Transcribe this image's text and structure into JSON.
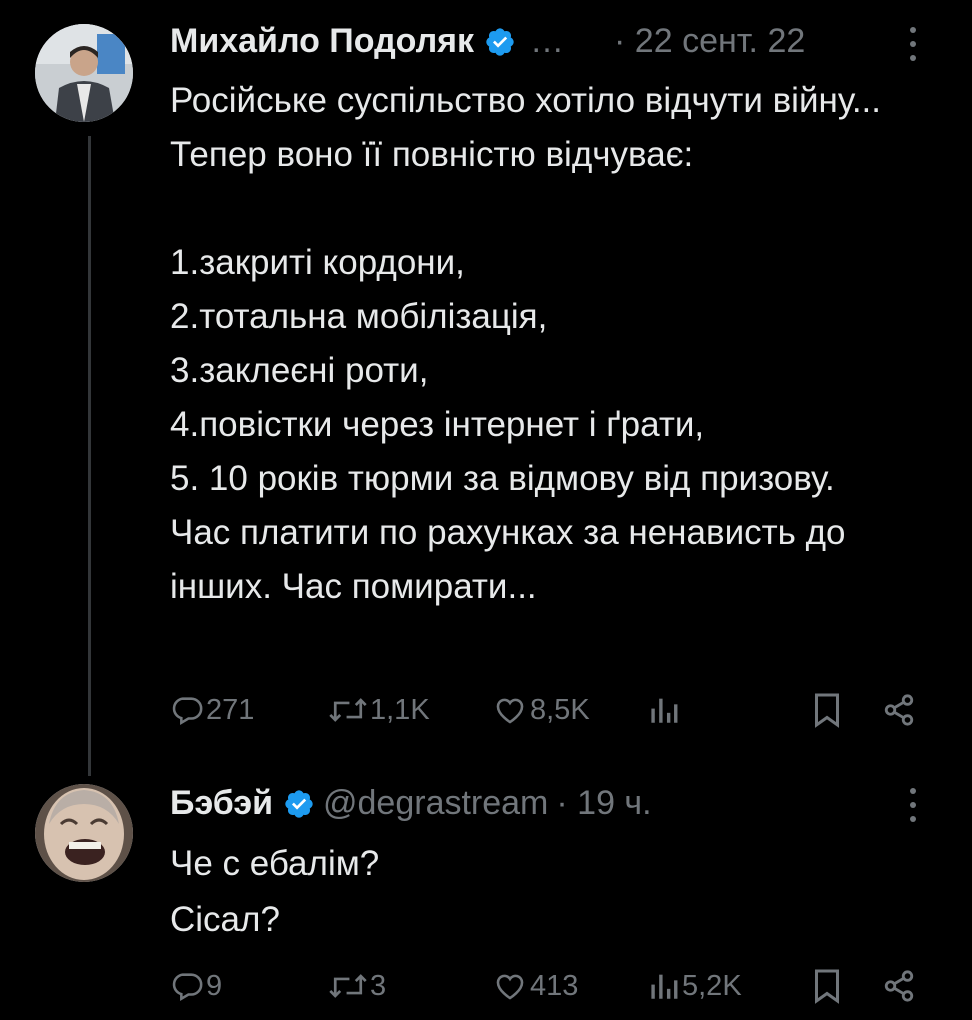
{
  "tweets": [
    {
      "author": "Михайло Подоляк",
      "handle": "…",
      "time": "· 22 сент. 22",
      "text": "Російське суспільство хотіло відчути війну... Тепер воно її повністю відчуває:\n\n1.закриті кордони,\n2.тотальна мобілізація,\n3.заклеєні роти,\n4.повістки через інтернет і ґрати,\n5. 10 років тюрми за відмову від призову.\nЧас платити по рахунках за ненависть до інших. Час помирати...",
      "replies": "271",
      "retweets": "1,1K",
      "likes": "8,5K",
      "views": ""
    },
    {
      "author": "Бэбэй",
      "handle": "@degrastream",
      "time": "· 19 ч.",
      "text": "Че с ебалім?\nСісал?",
      "replies": "9",
      "retweets": "3",
      "likes": "413",
      "views": "5,2K"
    }
  ],
  "colors": {
    "background": "#000000",
    "text": "#e7e9ea",
    "muted": "#71767b",
    "verified": "#1d9bf0",
    "thread_line": "#333639"
  },
  "icons": [
    "verified-badge-icon",
    "more-icon",
    "reply-icon",
    "retweet-icon",
    "like-icon",
    "views-icon",
    "bookmark-icon",
    "share-icon"
  ]
}
